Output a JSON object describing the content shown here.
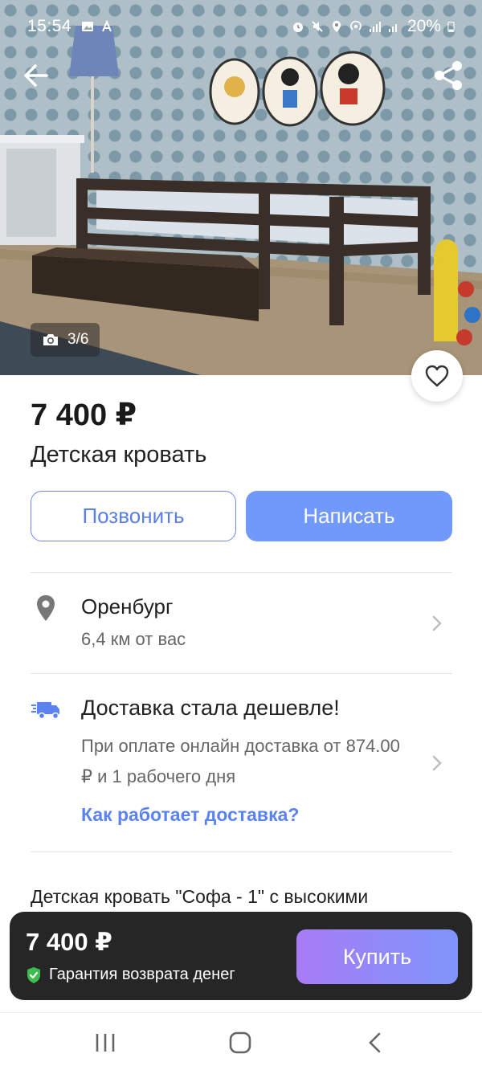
{
  "status_bar": {
    "time": "15:54",
    "battery": "20%"
  },
  "gallery": {
    "counter": "3/6"
  },
  "listing": {
    "price": "7 400 ₽",
    "title": "Детская кровать"
  },
  "actions": {
    "call_label": "Позвонить",
    "write_label": "Написать"
  },
  "location": {
    "city": "Оренбург",
    "distance": "6,4 км от вас"
  },
  "delivery": {
    "title": "Доставка стала дешевле!",
    "text": "При оплате онлайн доставка от 874.00 ₽ и 1 рабочего дня",
    "link": "Как работает доставка?"
  },
  "description": {
    "text": "Детская кровать \"Софа - 1\" с высокими"
  },
  "buy_bar": {
    "price": "7 400 ₽",
    "guarantee": "Гарантия возврата денег",
    "buy_label": "Купить"
  },
  "icons": {
    "back": "arrow-left-icon",
    "share": "share-icon",
    "camera": "camera-icon",
    "favorite": "heart-outline-icon",
    "location": "map-pin-icon",
    "delivery": "truck-icon",
    "chevron": "chevron-right-icon",
    "guarantee": "shield-check-icon",
    "nav_recent": "recent-apps-icon",
    "nav_home": "home-icon",
    "nav_back": "nav-back-icon"
  },
  "colors": {
    "accent": "#7198fb",
    "link": "#5b83f0",
    "buy_gradient_start": "#a77cf6",
    "buy_gradient_end": "#7f95fb",
    "buy_bar_bg": "#262626",
    "guarantee_check": "#3dbd4f"
  }
}
